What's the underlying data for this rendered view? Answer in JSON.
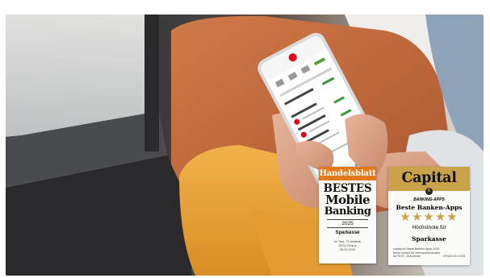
{
  "image": {
    "subject": "hands-holding-smartphone-banking-app",
    "colors": {
      "orange_clothing": "#e8a23a",
      "seat_orange": "#c4673a",
      "sparkasse_red": "#e3001b",
      "capital_gold": "#c9a24a",
      "handelsblatt_orange": "#e27a1a"
    }
  },
  "badges": {
    "handelsblatt": {
      "brand": "Handelsblatt",
      "line1": "BESTES",
      "line2": "Mobile",
      "line3": "Banking",
      "year": "2025",
      "institution": "Sparkasse",
      "fine_print": "Im Test: 75 Institute\nDISQ Finanz\n05.03.2025"
    },
    "capital": {
      "brand": "Capital",
      "category": "BANKING-APPS",
      "title": "Beste Banken-Apps",
      "stars": "★★★★★",
      "rating": "Höchstnote für",
      "institution": "Sparkasse",
      "fine_print": "capital.de Beste Banken-Apps 2025\nBerlin Institut für Verbraucherstudien\nIM TEST: 28 Anbieter",
      "fine_print_right": "CP.535.001.0225"
    }
  }
}
